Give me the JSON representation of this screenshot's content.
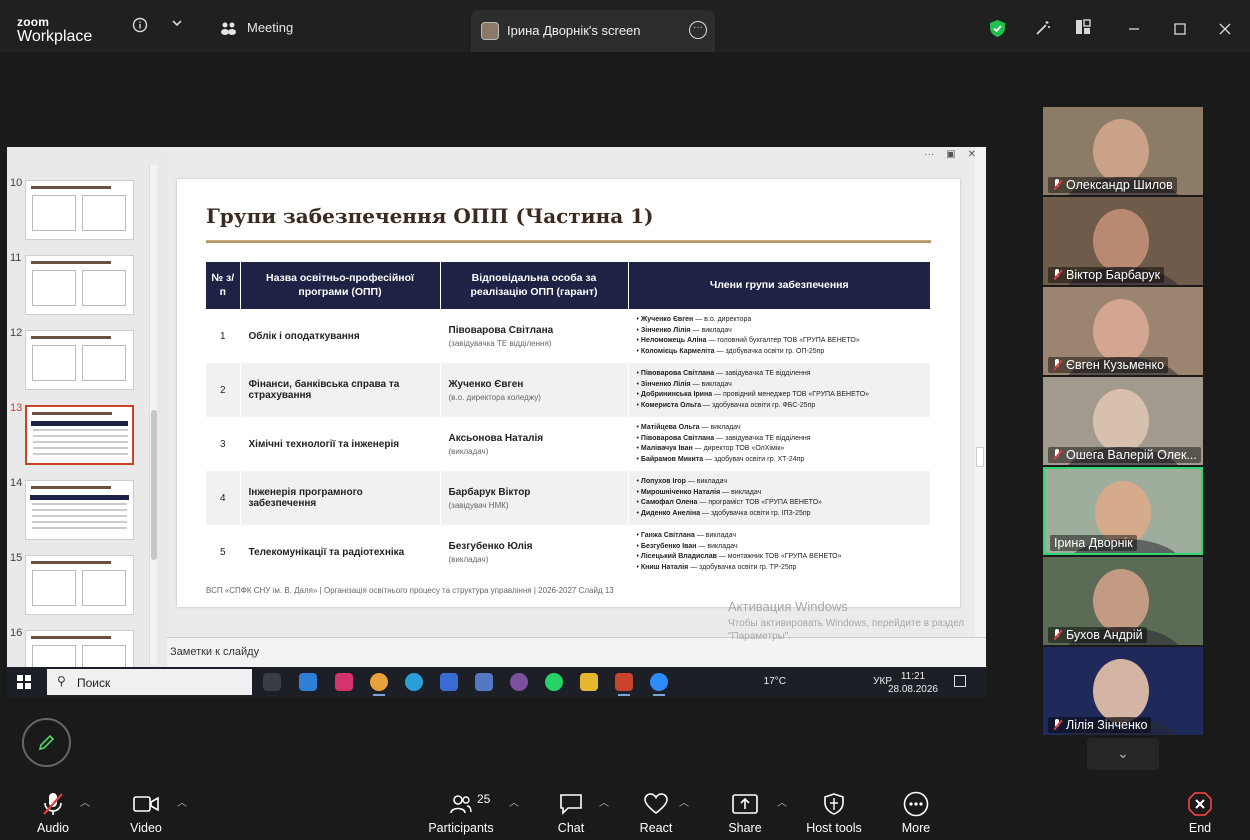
{
  "app": {
    "brand_top": "zoom",
    "brand_bottom": "Workplace"
  },
  "titlebar": {
    "meeting_label": "Meeting",
    "screen_tab_label": "Ірина Дворнік's screen",
    "info_icon": "info-icon",
    "security_icon": "shield-check-icon"
  },
  "shared_screen": {
    "thumbnails": [
      {
        "num": "10"
      },
      {
        "num": "11"
      },
      {
        "num": "12"
      },
      {
        "num": "13",
        "active": true
      },
      {
        "num": "14"
      },
      {
        "num": "15"
      },
      {
        "num": "16"
      }
    ],
    "slide": {
      "title": "Групи забезпечення ОПП (Частина 1)",
      "headers": [
        "№ з/п",
        "Назва освітньо-професійної програми (ОПП)",
        "Відповідальна особа за реалізацію ОПП (гарант)",
        "Члени групи забезпечення"
      ],
      "rows": [
        {
          "num": "1",
          "program": "Облік і оподаткування",
          "resp_name": "Півоварова Світлана",
          "resp_role": "(завідувачка ТЕ відділення)",
          "members": [
            {
              "name": "Жученко Євген",
              "role": " — в.о. директора"
            },
            {
              "name": "Зінченко Лілія",
              "role": " — викладач"
            },
            {
              "name": "Неломожець Аліна",
              "role": " — головний бухгалтер ТОВ «ГРУПА ВЕНЕТО»"
            },
            {
              "name": "Коломієць Кармеліта",
              "role": " — здобувачка освіти гр. ОП-25пр"
            }
          ]
        },
        {
          "num": "2",
          "program": "Фінанси, банківська справа та страхування",
          "resp_name": "Жученко Євген",
          "resp_role": "(в.о. директора коледжу)",
          "members": [
            {
              "name": "Півоварова Світлана",
              "role": " — завідувачка ТЕ відділення"
            },
            {
              "name": "Зінченко Лілія",
              "role": " — викладач"
            },
            {
              "name": "Добрининська Ірина",
              "role": " — провідний менеджер ТОВ «ГРУПА ВЕНЕТО»"
            },
            {
              "name": "Комериста Ольга",
              "role": " — здобувачка освіти гр. ФБС-25пр"
            }
          ]
        },
        {
          "num": "3",
          "program": "Хімічні технології та інженерія",
          "resp_name": "Аксьонова Наталія",
          "resp_role": "(викладач)",
          "members": [
            {
              "name": "Матійцева Ольга",
              "role": " — викладач"
            },
            {
              "name": "Півоварова Світлана",
              "role": " — завідувачка ТЕ відділення"
            },
            {
              "name": "Малівачук Іван",
              "role": " — директор ТОВ «ОлХімік»"
            },
            {
              "name": "Байрамов Микита",
              "role": " — здобувач освіти гр. ХТ-24пр"
            }
          ]
        },
        {
          "num": "4",
          "program": "Інженерія програмного забезпечення",
          "resp_name": "Барбарук Віктор",
          "resp_role": "(завідувач НМК)",
          "members": [
            {
              "name": "Лопухов Ігор",
              "role": " — викладач"
            },
            {
              "name": "Мирошніченко Наталія",
              "role": " — викладач"
            },
            {
              "name": "Самофал Олена",
              "role": " — програміст ТОВ «ГРУПА ВЕНЕТО»"
            },
            {
              "name": "Диденко Анеліна",
              "role": " — здобувачка освіти гр. ІПЗ-25пр"
            }
          ]
        },
        {
          "num": "5",
          "program": "Телекомунікації та радіотехніка",
          "resp_name": "Безгубенко Юлія",
          "resp_role": "(викладач)",
          "members": [
            {
              "name": "Ганжа Світлана",
              "role": " — викладач"
            },
            {
              "name": "Безгубенко Іван",
              "role": " — викладач"
            },
            {
              "name": "Лісецький Владислав",
              "role": " — монтажник ТОВ «ГРУПА ВЕНЕТО»"
            },
            {
              "name": "Книш Наталія",
              "role": " — здобувачка освіти гр. ТР-25пр"
            }
          ]
        }
      ],
      "footer": "ВСП «СПФК СНУ ім. В. Даля»  |  Організація освітнього процесу та структура управління  |  2026-2027     Слайд 13"
    },
    "notes_label": "Заметки к слайду",
    "activation": {
      "title": "Активация Windows",
      "text": "Чтобы активировать Windows, перейдите в раздел \"Параметры\"."
    },
    "taskbar": {
      "search_placeholder": "Поиск",
      "weather": "17°C",
      "lang": "УКР",
      "time": "11:21",
      "date": "28.08.2026"
    }
  },
  "participants": [
    {
      "name": "Олександр Шилов",
      "muted": true,
      "bg": "#8c7b67",
      "face": "#c9a287"
    },
    {
      "name": "Віктор Барбарук",
      "muted": true,
      "bg": "#6f5b4a",
      "face": "#b98a72"
    },
    {
      "name": "Євген Кузьменко",
      "muted": true,
      "bg": "#9b8470",
      "face": "#d2a690"
    },
    {
      "name": "Ошега Валерій Олек...",
      "muted": true,
      "bg": "#a29a8e",
      "face": "#d8c0ae"
    },
    {
      "name": "Ірина Дворнік",
      "muted": false,
      "bg": "#9fae9c",
      "face": "#d6ab8c"
    },
    {
      "name": "Бухов Андрій",
      "muted": true,
      "bg": "#5c6b56",
      "face": "#c29b82"
    },
    {
      "name": "Лілія Зінченко",
      "muted": true,
      "bg": "#1f2a5a",
      "face": "#d4b5a4"
    }
  ],
  "toolbar": {
    "audio": "Audio",
    "video": "Video",
    "participants": "Participants",
    "participants_count": "25",
    "chat": "Chat",
    "react": "React",
    "share": "Share",
    "host_tools": "Host tools",
    "more": "More",
    "end": "End"
  }
}
